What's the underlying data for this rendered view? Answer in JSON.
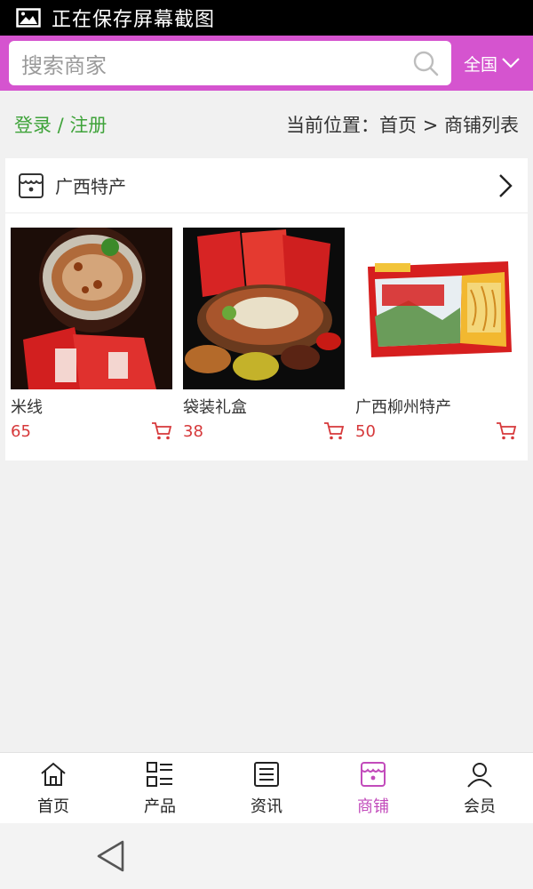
{
  "status_bar": {
    "text": "正在保存屏幕截图",
    "icon": "image-icon"
  },
  "header": {
    "search_placeholder": "搜索商家",
    "region_label": "全国",
    "accent_color": "#d554cf"
  },
  "crumbs": {
    "login": "登录 / 注册",
    "location": "当前位置：首页 > 商铺列表"
  },
  "shop": {
    "name": "广西特产",
    "products": [
      {
        "name": "米线",
        "price": "65"
      },
      {
        "name": "袋装礼盒",
        "price": "38"
      },
      {
        "name": "广西柳州特产",
        "price": "50"
      }
    ]
  },
  "bottom_nav": {
    "items": [
      {
        "label": "首页",
        "icon": "home-icon"
      },
      {
        "label": "产品",
        "icon": "list-icon"
      },
      {
        "label": "资讯",
        "icon": "news-icon"
      },
      {
        "label": "商铺",
        "icon": "store-icon",
        "active": true
      },
      {
        "label": "会员",
        "icon": "user-icon"
      }
    ]
  },
  "colors": {
    "price": "#d6383a",
    "login": "#3fa33a",
    "nav_active": "#c24bbb"
  }
}
